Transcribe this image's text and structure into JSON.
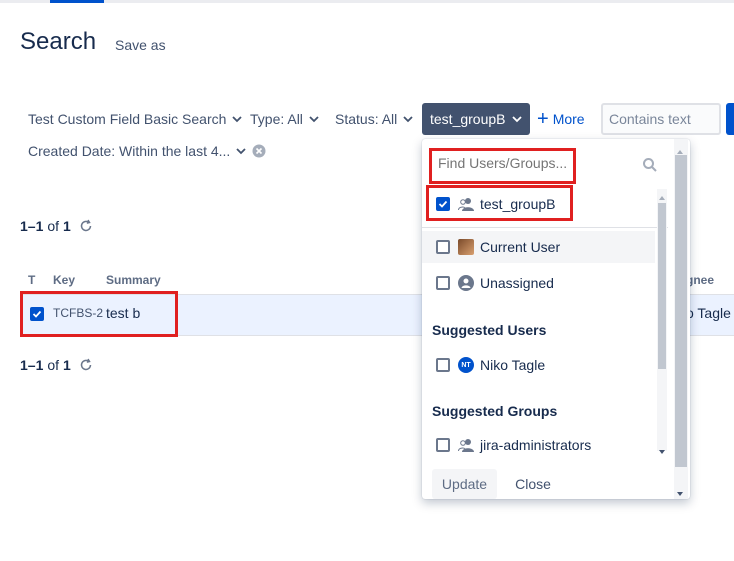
{
  "header": {
    "title": "Search",
    "save_as": "Save as"
  },
  "filters": {
    "project": "Test Custom Field Basic Search",
    "type": "Type: All",
    "status": "Status: All",
    "group": "test_groupB",
    "more": "More",
    "contains_placeholder": "Contains text",
    "created": "Created Date: Within the last 4..."
  },
  "results": {
    "range": "1–1",
    "of": "of",
    "total": "1"
  },
  "table": {
    "headers": {
      "type": "T",
      "key": "Key",
      "summary": "Summary",
      "assignee": "gnee"
    },
    "rows": [
      {
        "key": "TCFBS-2",
        "summary": "test b",
        "assignee": "o Tagle",
        "selected": true
      }
    ]
  },
  "dropdown": {
    "search_placeholder": "Find Users/Groups...",
    "selected_item": {
      "label": "test_groupB",
      "icon": "group-icon",
      "checked": true
    },
    "items": [
      {
        "label": "Current User",
        "icon": "user-avatar-icon",
        "checked": false
      },
      {
        "label": "Unassigned",
        "icon": "unassigned-user-icon",
        "checked": false
      }
    ],
    "suggested_users_heading": "Suggested Users",
    "suggested_users": [
      {
        "label": "Niko Tagle",
        "initials": "NT",
        "checked": false
      }
    ],
    "suggested_groups_heading": "Suggested Groups",
    "suggested_groups": [
      {
        "label": "jira-administrators",
        "icon": "group-icon",
        "checked": false
      }
    ],
    "update_label": "Update",
    "close_label": "Close"
  },
  "colors": {
    "primary": "#0052cc",
    "dark_button": "#42526e",
    "highlight_box": "#e02020",
    "row_selected": "#ebf2ff"
  }
}
